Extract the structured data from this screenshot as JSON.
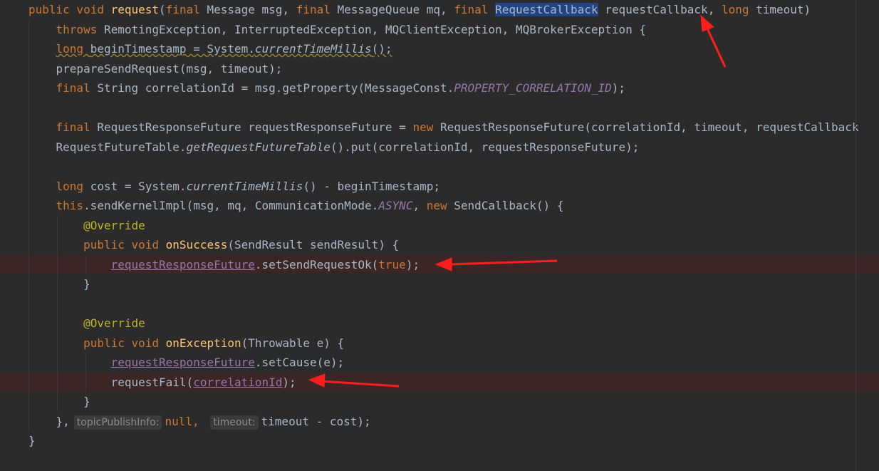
{
  "lines": [
    [
      {
        "t": "public void ",
        "c": "kw"
      },
      {
        "t": "request",
        "c": "fn"
      },
      {
        "t": "("
      },
      {
        "t": "final ",
        "c": "kw"
      },
      {
        "t": "Message msg, "
      },
      {
        "t": "final ",
        "c": "kw"
      },
      {
        "t": "MessageQueue mq, "
      },
      {
        "t": "final ",
        "c": "kw"
      },
      {
        "t": "RequestCallback",
        "c": "sel"
      },
      {
        "t": " requestCallback, "
      },
      {
        "t": "long ",
        "c": "kw"
      },
      {
        "t": "timeout)"
      }
    ],
    [
      {
        "t": "    "
      },
      {
        "t": "throws ",
        "c": "kw"
      },
      {
        "t": "RemotingException, InterruptedException, MQClientException, MQBrokerException {"
      }
    ],
    [
      {
        "t": "    "
      },
      {
        "t": "long ",
        "c": "kw warn"
      },
      {
        "t": "beginTimestamp = System.",
        "c": "warn"
      },
      {
        "t": "currentTimeMillis",
        "c": "ital warn"
      },
      {
        "t": "();",
        "c": "warn"
      }
    ],
    [
      {
        "t": "    prepareSendRequest(msg, timeout);"
      }
    ],
    [
      {
        "t": "    "
      },
      {
        "t": "final ",
        "c": "kw"
      },
      {
        "t": "String correlationId = msg.getProperty(MessageConst."
      },
      {
        "t": "PROPERTY_CORRELATION_ID",
        "c": "const"
      },
      {
        "t": ");"
      }
    ],
    [],
    [
      {
        "t": "    "
      },
      {
        "t": "final ",
        "c": "kw"
      },
      {
        "t": "RequestResponseFuture requestResponseFuture = "
      },
      {
        "t": "new ",
        "c": "kw"
      },
      {
        "t": "RequestResponseFuture(correlationId, timeout, requestCallback"
      }
    ],
    [
      {
        "t": "    RequestFutureTable."
      },
      {
        "t": "getRequestFutureTable",
        "c": "ital"
      },
      {
        "t": "().put(correlationId, requestResponseFuture);"
      }
    ],
    [],
    [
      {
        "t": "    "
      },
      {
        "t": "long ",
        "c": "kw"
      },
      {
        "t": "cost = System."
      },
      {
        "t": "currentTimeMillis",
        "c": "ital"
      },
      {
        "t": "() - beginTimestamp;"
      }
    ],
    [
      {
        "t": "    "
      },
      {
        "t": "this",
        "c": "kw"
      },
      {
        "t": ".sendKernelImpl(msg, mq, CommunicationMode."
      },
      {
        "t": "ASYNC",
        "c": "const"
      },
      {
        "t": ", "
      },
      {
        "t": "new ",
        "c": "kw"
      },
      {
        "t": "SendCallback() {"
      }
    ],
    [
      {
        "t": "        "
      },
      {
        "t": "@Override",
        "c": "ann"
      }
    ],
    [
      {
        "t": "        "
      },
      {
        "t": "public void ",
        "c": "kw"
      },
      {
        "t": "onSuccess",
        "c": "fn"
      },
      {
        "t": "(SendResult sendResult) {"
      }
    ],
    [
      {
        "t": "            "
      },
      {
        "t": "requestResponseFuture",
        "c": "field"
      },
      {
        "t": ".setSendRequestOk("
      },
      {
        "t": "true",
        "c": "kw"
      },
      {
        "t": ");"
      }
    ],
    [
      {
        "t": "        }"
      }
    ],
    [],
    [
      {
        "t": "        "
      },
      {
        "t": "@Override",
        "c": "ann"
      }
    ],
    [
      {
        "t": "        "
      },
      {
        "t": "public void ",
        "c": "kw"
      },
      {
        "t": "onException",
        "c": "fn"
      },
      {
        "t": "(Throwable e) {"
      }
    ],
    [
      {
        "t": "            "
      },
      {
        "t": "requestResponseFuture",
        "c": "field"
      },
      {
        "t": ".setCause(e);"
      }
    ],
    [
      {
        "t": "            requestFail("
      },
      {
        "t": "correlationId",
        "c": "field"
      },
      {
        "t": ");"
      }
    ],
    [
      {
        "t": "        }"
      }
    ],
    [
      {
        "t": "    },"
      },
      {
        "t": "topicPublishInfo:",
        "c": "hint"
      },
      {
        "t": "null, ",
        "c": "kw"
      },
      {
        "t": "timeout:",
        "c": "hint"
      },
      {
        "t": "timeout - cost);"
      }
    ],
    [
      {
        "t": "}"
      }
    ]
  ],
  "error_lines": [
    13,
    19
  ],
  "indent_guides": [
    {
      "line": 1,
      "levels": [
        0
      ]
    },
    {
      "line": 2,
      "levels": [
        0
      ]
    },
    {
      "line": 3,
      "levels": [
        0
      ]
    },
    {
      "line": 4,
      "levels": [
        0
      ]
    },
    {
      "line": 5,
      "levels": [
        0
      ]
    },
    {
      "line": 6,
      "levels": [
        0
      ]
    },
    {
      "line": 7,
      "levels": [
        0
      ]
    },
    {
      "line": 8,
      "levels": [
        0
      ]
    },
    {
      "line": 9,
      "levels": [
        0
      ]
    },
    {
      "line": 10,
      "levels": [
        0
      ]
    },
    {
      "line": 11,
      "levels": [
        0,
        1
      ]
    },
    {
      "line": 12,
      "levels": [
        0,
        1
      ]
    },
    {
      "line": 13,
      "levels": [
        0,
        1,
        2
      ]
    },
    {
      "line": 14,
      "levels": [
        0,
        1
      ]
    },
    {
      "line": 15,
      "levels": [
        0,
        1
      ]
    },
    {
      "line": 16,
      "levels": [
        0,
        1
      ]
    },
    {
      "line": 17,
      "levels": [
        0,
        1
      ]
    },
    {
      "line": 18,
      "levels": [
        0,
        1,
        2
      ]
    },
    {
      "line": 19,
      "levels": [
        0,
        1,
        2
      ]
    },
    {
      "line": 20,
      "levels": [
        0,
        1
      ]
    },
    {
      "line": 21,
      "levels": [
        0
      ]
    }
  ],
  "colors": {
    "background": "#2b2b2b",
    "keyword": "#cc7832",
    "method": "#ffc66d",
    "field": "#9876aa",
    "annotation": "#bbb529",
    "text": "#a9b7c6",
    "arrow": "#ff1e1e"
  }
}
